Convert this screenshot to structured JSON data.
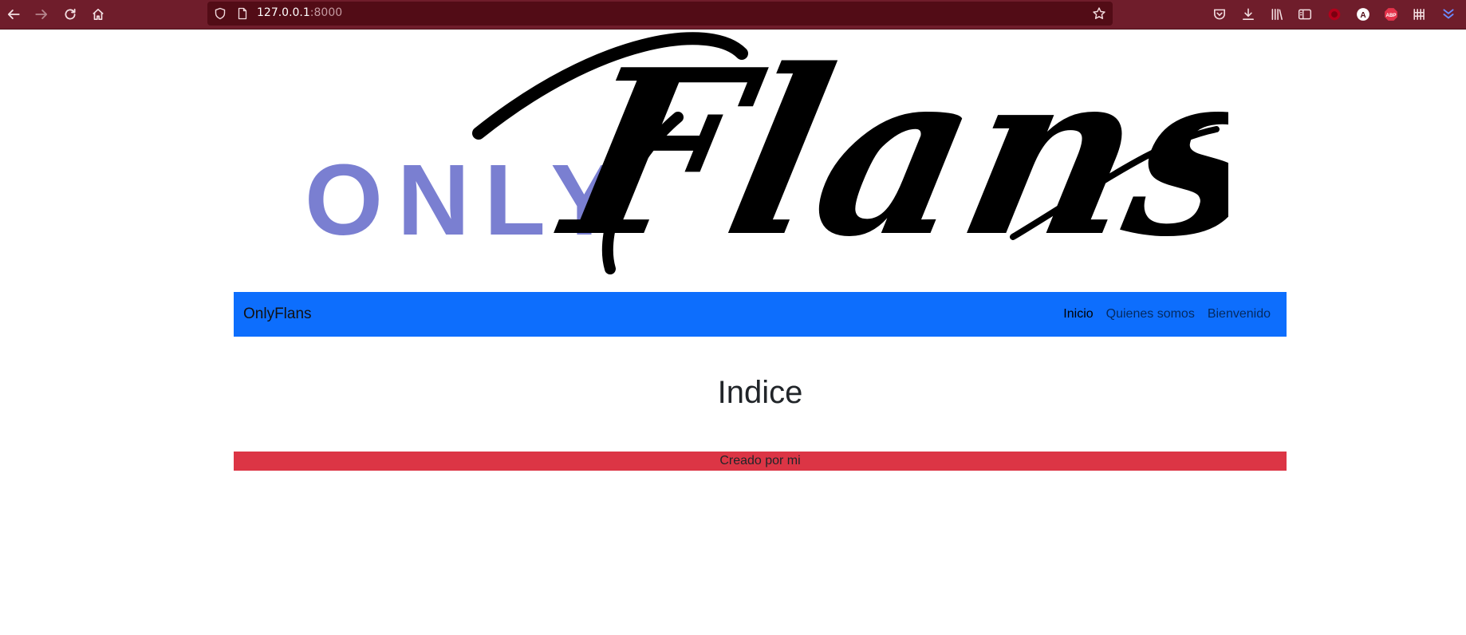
{
  "browser": {
    "url_host": "127.0.0.1",
    "url_port": ":8000",
    "extensions": [
      "pocket-icon",
      "download-icon",
      "library-icon",
      "sidebar-icon",
      "ublock-icon",
      "account-icon",
      "adblock-plus-icon",
      "extension-grid-icon",
      "overflow-icon"
    ],
    "adblock_text": "ABP",
    "account_letter": "A"
  },
  "logo": {
    "only_text": "ONLY",
    "flans_text": "Flans",
    "only_color": "#7a7fd1",
    "flans_color": "#000000"
  },
  "navbar": {
    "brand": "OnlyFlans",
    "links": [
      {
        "label": "Inicio",
        "active": true
      },
      {
        "label": "Quienes somos",
        "active": false
      },
      {
        "label": "Bienvenido",
        "active": false
      }
    ],
    "background": "#0d6efd"
  },
  "main": {
    "title": "Indice"
  },
  "footer": {
    "text": "Creado por mi",
    "background": "#dc3545"
  }
}
